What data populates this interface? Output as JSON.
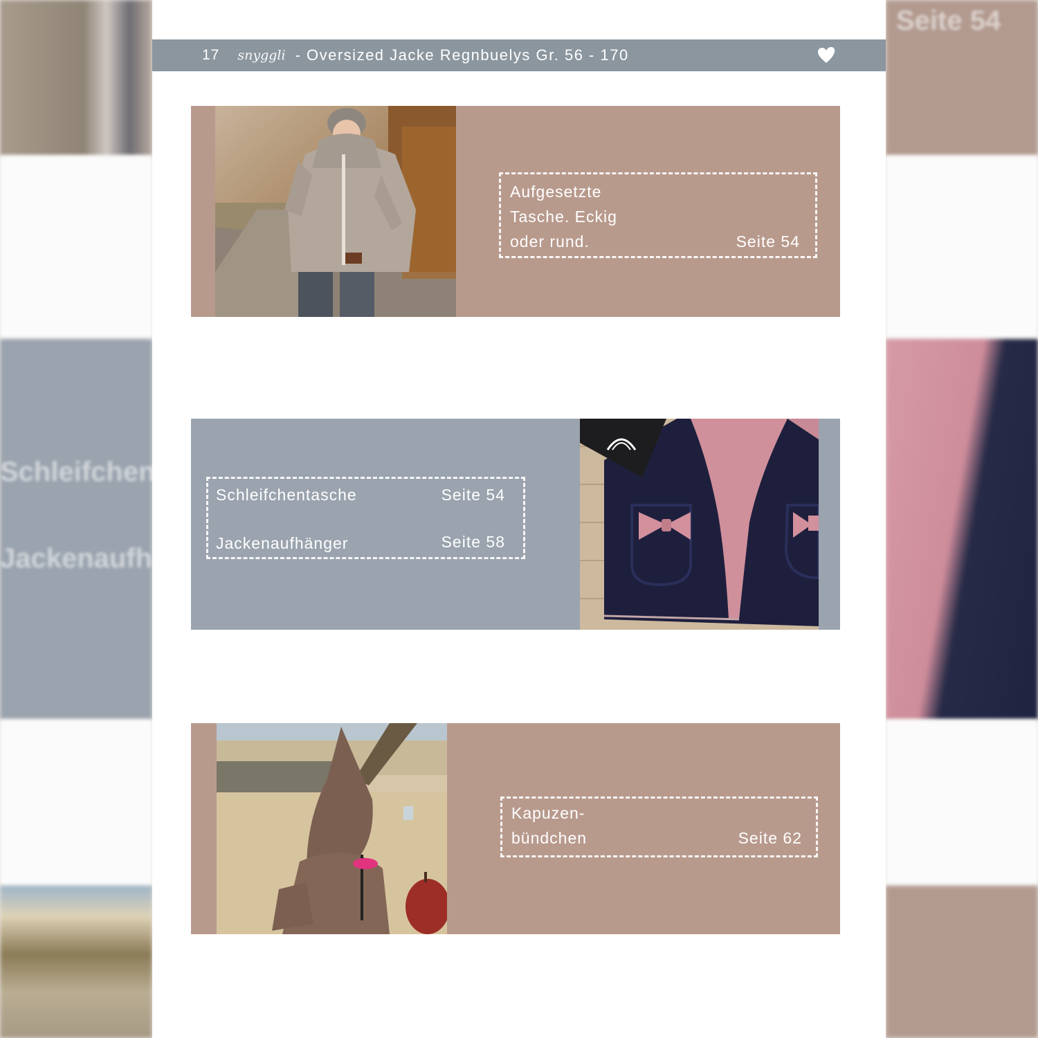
{
  "header": {
    "page_number": "17",
    "brand": "snyggli",
    "title": "- Oversized Jacke Regnbuelys Gr. 56 - 170",
    "icon": "heart-icon"
  },
  "cards": [
    {
      "lines": [
        "Aufgesetzte",
        "Tasche. Eckig",
        "oder rund."
      ],
      "page": "Seite 54"
    },
    {
      "items": [
        {
          "label": "Schleifchentasche",
          "page": "Seite 54"
        },
        {
          "label": "Jackenaufhänger",
          "page": "Seite 58"
        }
      ]
    },
    {
      "lines": [
        "Kapuzen-",
        "bündchen"
      ],
      "page": "Seite 62"
    }
  ],
  "colors": {
    "header": "#8b969f",
    "rose": "#b89a8d",
    "grey": "#9aa3ae",
    "text": "#ffffff"
  }
}
